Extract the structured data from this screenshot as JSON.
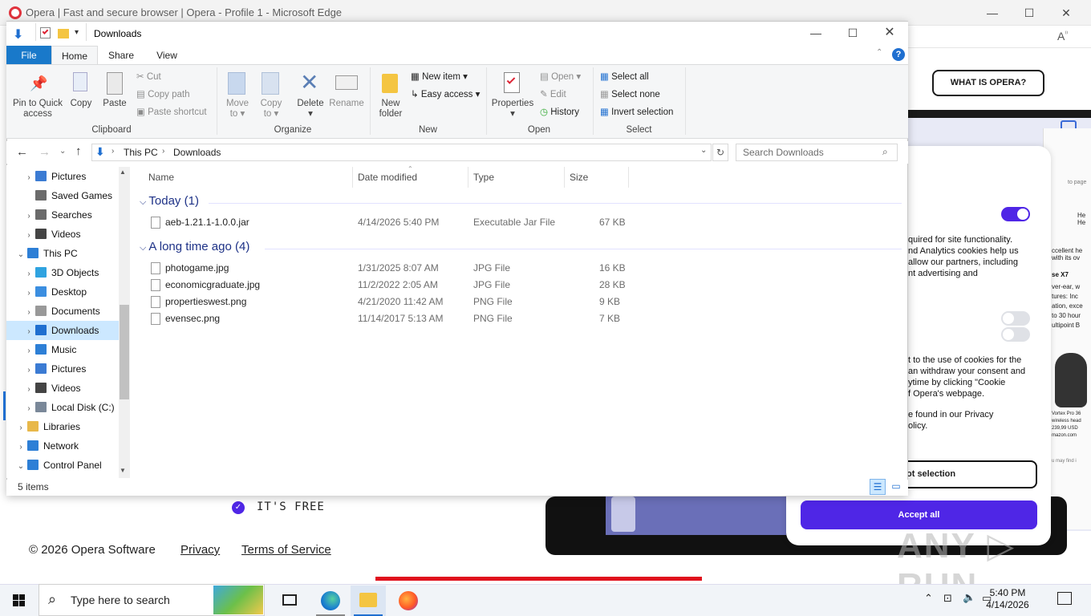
{
  "edge": {
    "title": "Opera | Fast and secure browser | Opera - Profile 1 - Microsoft Edge",
    "what_is_opera": "WHAT IS OPERA?",
    "cookie": {
      "para1": "quired for site functionality.\nnd Analytics cookies help us\nallow our partners, including\nnt advertising and",
      "para1_link": "advertising and",
      "para2": "t to the use of cookies for the\nan withdraw your consent and\nytime by clicking \"Cookie\nf Opera's webpage.",
      "para3": "e found in our Privacy\nolicy.",
      "reject_label": "ot selection",
      "accept_label": "Accept all"
    },
    "its_free": "IT'S FREE",
    "copyright": "© 2026 Opera Software",
    "privacy_link": "Privacy",
    "tos_link": "Terms of Service",
    "side_texts": [
      "to page",
      "He\nHe",
      "ccellent he\nwith its ov",
      "se X7",
      "ver-ear, w\ntures: Inc\nation, exce\nto 30 hour\nultipoint B",
      "Vortex Pro 36\nwireless head\n239,99 USD\nmazon.com",
      "u may find i"
    ],
    "watermark": "ANY RUN"
  },
  "explorer": {
    "title": "Downloads",
    "tabs": [
      "File",
      "Home",
      "Share",
      "View"
    ],
    "ribbon": {
      "clipboard": {
        "pin": "Pin to Quick\naccess",
        "copy": "Copy",
        "paste": "Paste",
        "cut": "Cut",
        "copy_path": "Copy path",
        "paste_shortcut": "Paste shortcut",
        "label": "Clipboard"
      },
      "organize": {
        "move_to": "Move\nto ▾",
        "copy_to": "Copy\nto ▾",
        "delete": "Delete\n▾",
        "rename": "Rename",
        "label": "Organize"
      },
      "new": {
        "new_folder": "New\nfolder",
        "new_item": "New item ▾",
        "easy_access": "Easy access ▾",
        "label": "New"
      },
      "open": {
        "properties": "Properties\n▾",
        "open": "Open ▾",
        "edit": "Edit",
        "history": "History",
        "label": "Open"
      },
      "select": {
        "select_all": "Select all",
        "select_none": "Select none",
        "invert": "Invert selection",
        "label": "Select"
      }
    },
    "address": {
      "crumbs": [
        "This PC",
        "Downloads"
      ],
      "search_placeholder": "Search Downloads"
    },
    "nav": [
      {
        "label": "Pictures",
        "indent": 1,
        "expand": "›",
        "color": "#3b7bd3"
      },
      {
        "label": "Saved Games",
        "indent": 1,
        "expand": "",
        "color": "#6b6b6b"
      },
      {
        "label": "Searches",
        "indent": 1,
        "expand": "›",
        "color": "#6b6b6b"
      },
      {
        "label": "Videos",
        "indent": 1,
        "expand": "›",
        "color": "#444"
      },
      {
        "label": "This PC",
        "indent": 0,
        "expand": "⌄",
        "color": "#2d7fd6"
      },
      {
        "label": "3D Objects",
        "indent": 1,
        "expand": "›",
        "color": "#2fa3e0"
      },
      {
        "label": "Desktop",
        "indent": 1,
        "expand": "›",
        "color": "#3b8ee0"
      },
      {
        "label": "Documents",
        "indent": 1,
        "expand": "›",
        "color": "#999"
      },
      {
        "label": "Downloads",
        "indent": 1,
        "expand": "›",
        "color": "#1f6fd0",
        "selected": true
      },
      {
        "label": "Music",
        "indent": 1,
        "expand": "›",
        "color": "#2d7fd6"
      },
      {
        "label": "Pictures",
        "indent": 1,
        "expand": "›",
        "color": "#3b7bd3"
      },
      {
        "label": "Videos",
        "indent": 1,
        "expand": "›",
        "color": "#444"
      },
      {
        "label": "Local Disk (C:)",
        "indent": 1,
        "expand": "›",
        "color": "#7a8899"
      },
      {
        "label": "Libraries",
        "indent": 0,
        "expand": "›",
        "color": "#e8b84a"
      },
      {
        "label": "Network",
        "indent": 0,
        "expand": "›",
        "color": "#2d7fd6"
      },
      {
        "label": "Control Panel",
        "indent": 0,
        "expand": "⌄",
        "color": "#2d7fd6"
      }
    ],
    "columns": [
      "Name",
      "Date modified",
      "Type",
      "Size"
    ],
    "groups": [
      {
        "header": "Today (1)",
        "files": [
          {
            "name": "aeb-1.21.1-1.0.0.jar",
            "date": "4/14/2026 5:40 PM",
            "type": "Executable Jar File",
            "size": "67 KB"
          }
        ]
      },
      {
        "header": "A long time ago (4)",
        "files": [
          {
            "name": "photogame.jpg",
            "date": "1/31/2025 8:07 AM",
            "type": "JPG File",
            "size": "16 KB"
          },
          {
            "name": "economicgraduate.jpg",
            "date": "11/2/2022 2:05 AM",
            "type": "JPG File",
            "size": "28 KB"
          },
          {
            "name": "propertieswest.png",
            "date": "4/21/2020 11:42 AM",
            "type": "PNG File",
            "size": "9 KB"
          },
          {
            "name": "evensec.png",
            "date": "11/14/2017 5:13 AM",
            "type": "PNG File",
            "size": "7 KB"
          }
        ]
      }
    ],
    "status": "5 items"
  },
  "taskbar": {
    "search_placeholder": "Type here to search",
    "time": "5:40 PM",
    "date": "4/14/2026"
  }
}
